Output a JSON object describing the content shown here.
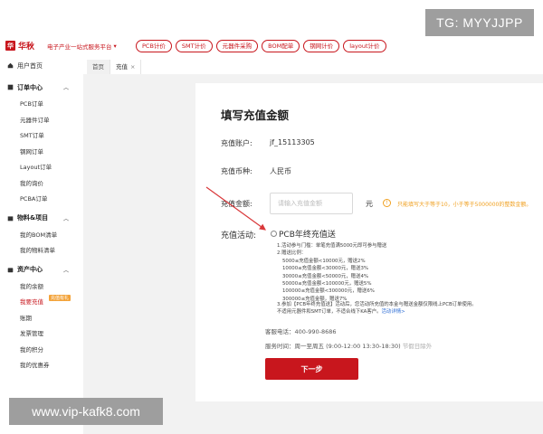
{
  "header": {
    "logo_mark": "华",
    "logo_text": "华秋",
    "tagline": "电子产业一站式服务平台",
    "nav": [
      "PCB计价",
      "SMT计价",
      "元器件采购",
      "BOM配单",
      "钢网计价",
      "layout计价"
    ]
  },
  "tg_badge": "TG: MYYJJPP",
  "sidebar": {
    "home": "用户首页",
    "sections": [
      {
        "title": "订单中心",
        "items": [
          "PCB订单",
          "元器件订单",
          "SMT订单",
          "钢网订单",
          "Layout订单",
          "我的询价",
          "PCBA订单"
        ]
      },
      {
        "title": "物料&项目",
        "items": [
          "我的BOM清单",
          "我的物料清单"
        ]
      },
      {
        "title": "资产中心",
        "items": [
          "我的余额",
          "我要充值",
          "账期",
          "发票管理",
          "我的积分",
          "我的优惠券"
        ]
      }
    ],
    "active_badge": "充值有礼"
  },
  "tabs": [
    {
      "label": "首页"
    },
    {
      "label": "充值",
      "close": "×"
    }
  ],
  "form": {
    "title": "填写充值金额",
    "account_label": "充值账户:",
    "account_value": "jf_15113305",
    "currency_label": "充值币种:",
    "currency_value": "人民币",
    "amount_label": "充值金额:",
    "amount_placeholder": "请输入充值金额",
    "unit": "元",
    "warn_icon": "!",
    "warning": "只能填写大于等于10，小于等于5000000的整数金额。",
    "promo_label": "充值活动:",
    "promo_name": "PCB年终充值送",
    "rules": [
      "1.活动参与门槛：单笔充值满5000元即可参与赠送",
      "2.赠送比例：",
      "5000≤充值金额<10000元，赠送2%",
      "10000≤充值金额<30000元，赠送3%",
      "30000≤充值金额<50000元，赠送4%",
      "50000≤充值金额<100000元，赠送5%",
      "100000≤充值金额<300000元，赠送6%",
      "300000≤充值金额，赠送7%"
    ],
    "rule3": "3.参加【PCB年终充值送】活动后，您活动所充值的本金与赠送金额仅限线上PCB订单使用。",
    "rule3b": "不适用元器件和SMT订单，不适合线下KA客户。",
    "rule_link": "活动详情>",
    "service_phone": "客服电话：400-990-8686",
    "service_time": "服务时间：周一至周五 (9:00-12:00 13:30-18:30)",
    "service_note": "节假日除外",
    "next_button": "下一步"
  },
  "watermark": "www.vip-kafk8.com"
}
